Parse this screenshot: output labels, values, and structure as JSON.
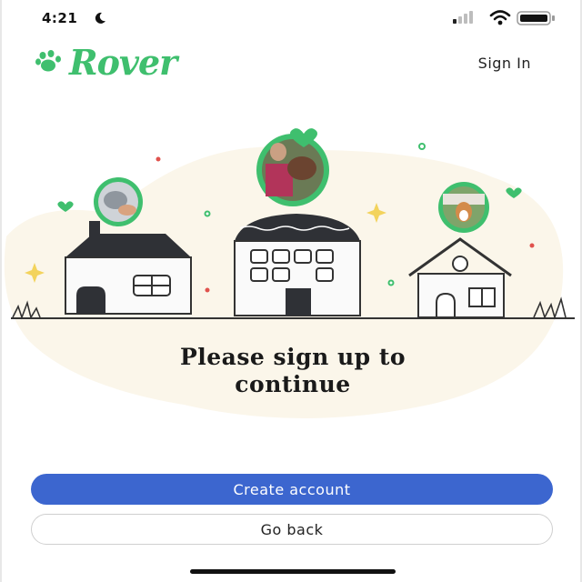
{
  "status_bar": {
    "time": "4:21",
    "icons": [
      "moon-icon",
      "signal-icon",
      "wifi-icon",
      "battery-icon"
    ]
  },
  "header": {
    "logo_text": "Rover",
    "logo_icon": "paw-icon",
    "sign_in_label": "Sign In"
  },
  "main": {
    "heading": "Please sign up to\ncontinue"
  },
  "actions": {
    "create_account_label": "Create account",
    "go_back_label": "Go back"
  },
  "colors": {
    "brand_green": "#3fbf6e",
    "primary_blue": "#3c66cf",
    "illustration_bg": "#fbf6ea"
  }
}
